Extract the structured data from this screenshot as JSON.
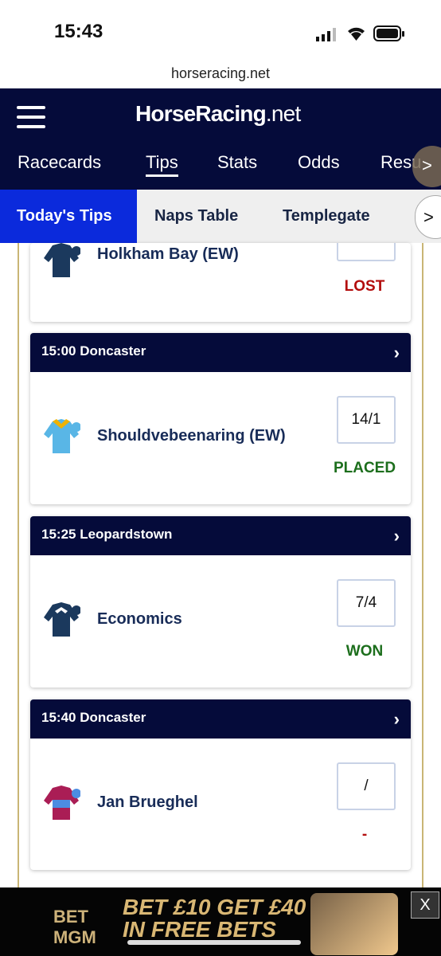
{
  "status": {
    "time": "15:43"
  },
  "browser": {
    "url": "horseracing.net"
  },
  "header": {
    "logo_bold": "HorseRacing",
    "logo_suffix": "net"
  },
  "nav": {
    "items": [
      "Racecards",
      "Tips",
      "Stats",
      "Odds",
      "Resu"
    ]
  },
  "subnav": {
    "items": [
      "Today's Tips",
      "Naps Table",
      "Templegate"
    ]
  },
  "cards": [
    {
      "horse": "Holkham Bay (EW)",
      "result": "LOST",
      "result_color": "#b30d0d"
    },
    {
      "race": "15:00 Doncaster",
      "horse": "Shouldvebeenaring (EW)",
      "odds": "14/1",
      "result": "PLACED",
      "result_color": "#1c6e1c"
    },
    {
      "race": "15:25 Leopardstown",
      "horse": "Economics",
      "odds": "7/4",
      "result": "WON",
      "result_color": "#1c6e1c"
    },
    {
      "race": "15:40 Doncaster",
      "horse": "Jan Brueghel",
      "odds": "/",
      "result": "-",
      "result_color": "#b30d0d"
    }
  ],
  "ad": {
    "brand_top": "BET",
    "brand_bottom": "MGM",
    "line1": "BET £10 GET £40",
    "line2": "IN FREE BETS",
    "close": "X"
  },
  "icons": [
    "hamburger-icon",
    "chevron-right-icon",
    "jockey-silks-icon",
    "signal-icon",
    "wifi-icon",
    "battery-icon"
  ]
}
